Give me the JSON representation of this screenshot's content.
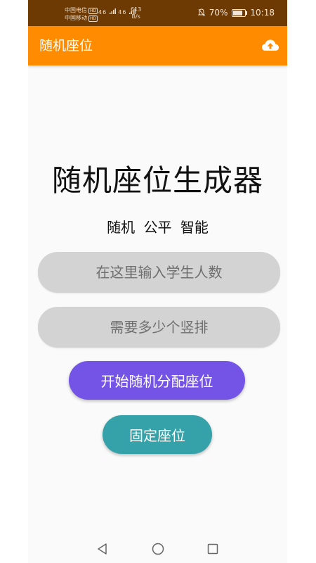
{
  "status_bar": {
    "carrier1": "中国电信",
    "carrier2": "中国移动",
    "hd_badge": "HD",
    "signal1": "46",
    "signal2": "46",
    "speed_value": "613",
    "speed_unit": "B/s",
    "battery_text": "70%",
    "battery_level": 0.7,
    "time": "10:18"
  },
  "toolbar": {
    "title": "随机座位",
    "upload_icon": "cloud-upload-icon",
    "background": "#ff8c00"
  },
  "main": {
    "title": "随机座位生成器",
    "subtitle": "随机  公平  智能",
    "students_placeholder": "在这里输入学生人数",
    "columns_placeholder": "需要多少个竖排",
    "random_button": "开始随机分配座位",
    "fixed_button": "固定座位"
  },
  "colors": {
    "status_bar": "#6d3a03",
    "accent_orange": "#ff8c00",
    "input_bg": "#d3d3d3",
    "random_button": "#7354e6",
    "fixed_button": "#35a1a8"
  },
  "nav": {
    "back_icon": "triangle-back-icon",
    "home_icon": "circle-home-icon",
    "recent_icon": "square-recent-icon"
  }
}
